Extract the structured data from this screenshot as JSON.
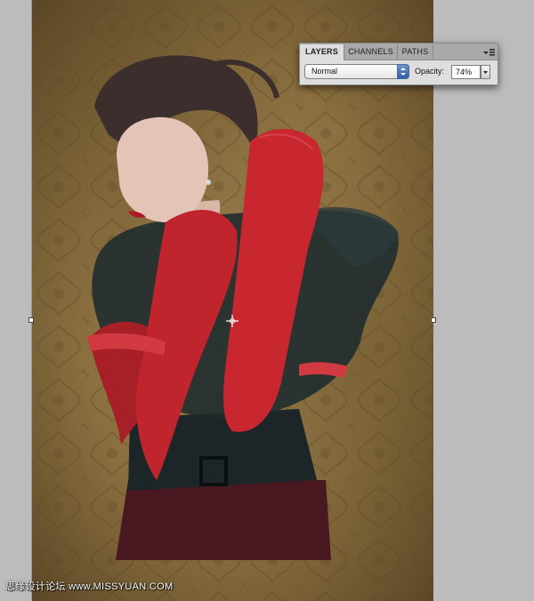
{
  "panel": {
    "tabs": [
      {
        "label": "LAYERS",
        "active": true
      },
      {
        "label": "CHANNELS",
        "active": false
      },
      {
        "label": "PATHS",
        "active": false
      }
    ],
    "menu_icon": "panel-menu-icon",
    "blend_mode": "Normal",
    "opacity_label": "Opacity:",
    "opacity_value": "74%"
  },
  "watermark": "思缘设计论坛 www.MISSYUAN.COM",
  "colors": {
    "background_texture": "#8a6f3f",
    "glove": "#c0242c",
    "panel_bg": "#dedede",
    "select_arrow": "#2e5fa8"
  }
}
